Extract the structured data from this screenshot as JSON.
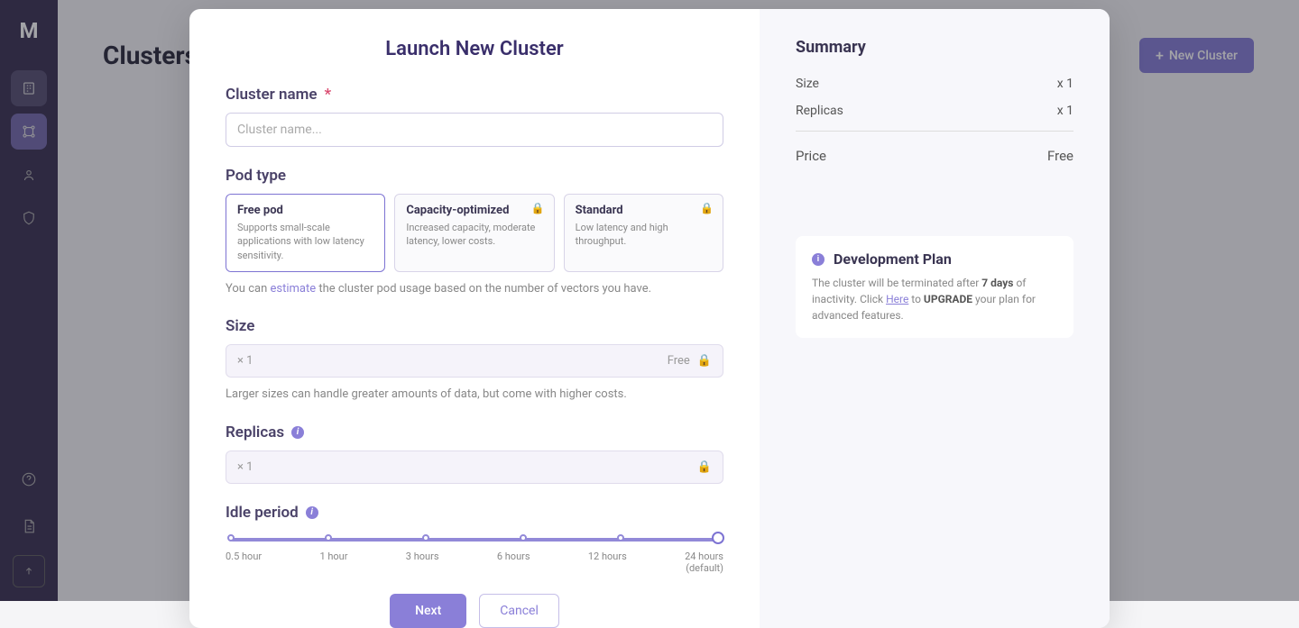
{
  "sidebar": {
    "logo": "M"
  },
  "page": {
    "title": "Clusters",
    "new_button": "New Cluster"
  },
  "modal": {
    "title": "Launch New Cluster",
    "cluster_name": {
      "label": "Cluster name",
      "placeholder": "Cluster name..."
    },
    "pod_type": {
      "label": "Pod type",
      "options": [
        {
          "title": "Free pod",
          "desc": "Supports small-scale applications with low latency sensitivity.",
          "locked": false,
          "selected": true
        },
        {
          "title": "Capacity-optimized",
          "desc": "Increased capacity, moderate latency, lower costs.",
          "locked": true,
          "selected": false
        },
        {
          "title": "Standard",
          "desc": "Low latency and high throughput.",
          "locked": true,
          "selected": false
        }
      ],
      "helper_pre": "You can ",
      "helper_link": "estimate",
      "helper_post": " the cluster pod usage based on the number of vectors you have."
    },
    "size": {
      "label": "Size",
      "value": "× 1",
      "badge": "Free",
      "helper": "Larger sizes can handle greater amounts of data, but come with higher costs."
    },
    "replicas": {
      "label": "Replicas",
      "value": "× 1"
    },
    "idle": {
      "label": "Idle period",
      "stops": [
        "0.5 hour",
        "1 hour",
        "3 hours",
        "6 hours",
        "12 hours",
        "24 hours"
      ],
      "default_sub": "(default)"
    },
    "buttons": {
      "next": "Next",
      "cancel": "Cancel"
    }
  },
  "summary": {
    "title": "Summary",
    "rows": [
      {
        "label": "Size",
        "value": "x 1"
      },
      {
        "label": "Replicas",
        "value": "x 1"
      }
    ],
    "price_label": "Price",
    "price_value": "Free"
  },
  "plan_card": {
    "title": "Development Plan",
    "line1_pre": "The cluster will be terminated after ",
    "line1_bold": "7 days",
    "line1_post": " of inactivity.",
    "line2_pre": "Click ",
    "line2_link": "Here",
    "line2_mid": " to ",
    "line2_bold": "UPGRADE",
    "line2_post": " your plan for advanced features."
  }
}
